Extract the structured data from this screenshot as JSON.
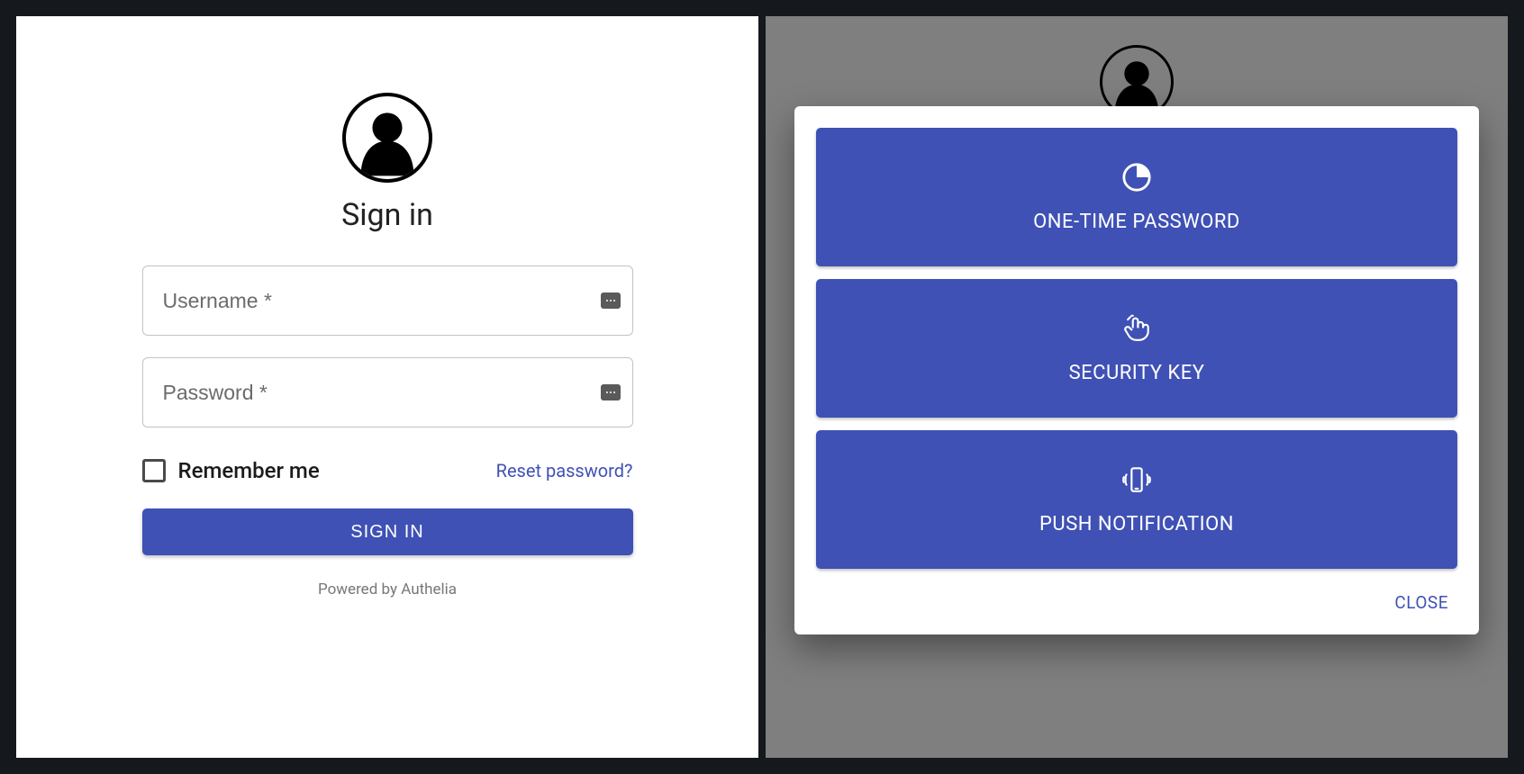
{
  "colors": {
    "accent": "#3f51b5"
  },
  "login": {
    "title": "Sign in",
    "username_placeholder": "Username *",
    "password_placeholder": "Password *",
    "remember_label": "Remember me",
    "reset_label": "Reset password?",
    "submit_label": "SIGN IN",
    "powered_label": "Powered by Authelia"
  },
  "mfa": {
    "methods": [
      {
        "label": "ONE-TIME PASSWORD",
        "icon": "otp-clock-icon"
      },
      {
        "label": "SECURITY KEY",
        "icon": "touch-icon"
      },
      {
        "label": "PUSH NOTIFICATION",
        "icon": "phone-vibrate-icon"
      }
    ],
    "close_label": "CLOSE"
  }
}
